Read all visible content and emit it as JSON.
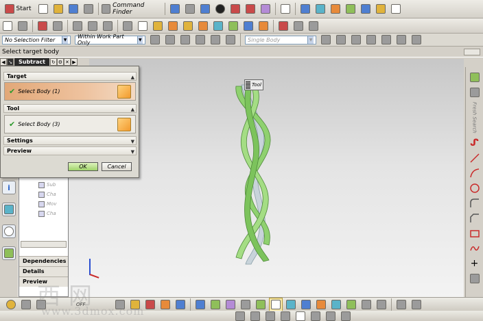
{
  "toolbar_top": {
    "start_label": "Start",
    "command_finder_label": "Command Finder"
  },
  "toolbar_filter": {
    "selection_filter": "No Selection Filter",
    "scope": "Within Work Part Only",
    "body_filter": "Single Body"
  },
  "status": {
    "prompt": "Select target body"
  },
  "dialog": {
    "title": "Subtract",
    "groups": {
      "target": "Target",
      "tool": "Tool",
      "settings": "Settings",
      "preview": "Preview"
    },
    "target_selection": "Select Body (1)",
    "tool_selection": "Select Body (3)",
    "ok_label": "OK",
    "cancel_label": "Cancel"
  },
  "part_navigator": {
    "items": [
      "Sub",
      "Cha",
      "Mov",
      "Cha"
    ],
    "sections": [
      "Dependencies",
      "Details",
      "Preview"
    ]
  },
  "viewport": {
    "tool_tag": "Tool"
  },
  "right_toolbar": {
    "label": "Fresh Search"
  },
  "bottom": {
    "triad_label": "OFF"
  },
  "watermark": {
    "chars": "西网",
    "url": "www.3dmox.com"
  },
  "colors": {
    "model_green": "#8fd16f",
    "target_highlight": "#e2a878",
    "ok_button": "#9fd36a"
  }
}
